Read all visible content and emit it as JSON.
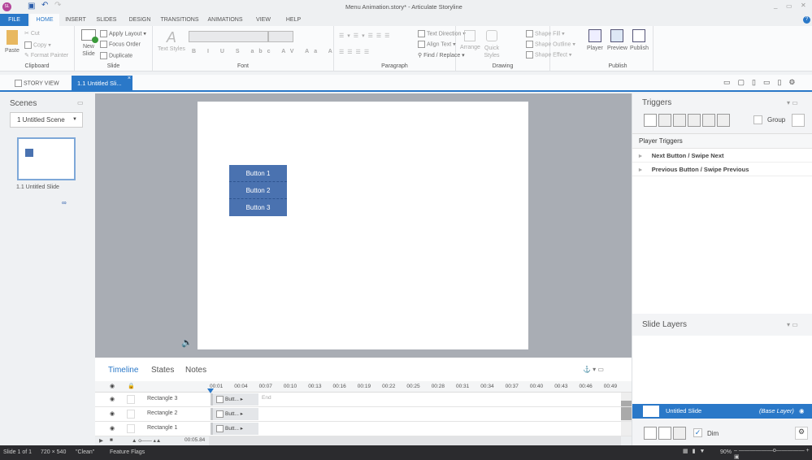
{
  "window": {
    "title": "Menu Animation.story* -  Articulate Storyline",
    "app_icon": "SL"
  },
  "ribbon_tabs": [
    "FILE",
    "HOME",
    "INSERT",
    "SLIDES",
    "DESIGN",
    "TRANSITIONS",
    "ANIMATIONS",
    "VIEW",
    "HELP"
  ],
  "clipboard": {
    "paste": "Paste",
    "cut": "Cut",
    "copy": "Copy",
    "format_painter": "Format Painter",
    "label": "Clipboard"
  },
  "slide_grp": {
    "new_slide": "New Slide",
    "apply_layout": "Apply Layout",
    "focus_order": "Focus Order",
    "duplicate": "Duplicate",
    "label": "Slide"
  },
  "font_grp": {
    "text_styles": "Text Styles",
    "label": "Font"
  },
  "paragraph_grp": {
    "text_direction": "Text Direction",
    "align_text": "Align Text",
    "find_replace": "Find / Replace",
    "label": "Paragraph"
  },
  "drawing_grp": {
    "arrange": "Arrange",
    "quick_styles": "Quick Styles",
    "shape_fill": "Shape Fill",
    "shape_outline": "Shape Outline",
    "shape_effect": "Shape Effect",
    "label": "Drawing"
  },
  "publish_grp": {
    "player": "Player",
    "preview": "Preview",
    "publish": "Publish",
    "label": "Publish"
  },
  "doc_tabs": {
    "story_view": "STORY VIEW",
    "active": "1.1 Untitled Sli..."
  },
  "scenes": {
    "title": "Scenes",
    "dropdown": "1 Untitled Scene",
    "slide_label": "1.1 Untitled Slide"
  },
  "slide": {
    "buttons": [
      "Button 1",
      "Button 2",
      "Button 3"
    ]
  },
  "timeline": {
    "tabs": [
      "Timeline",
      "States",
      "Notes"
    ],
    "ticks": [
      "00:01",
      "00:04",
      "00:07",
      "00:10",
      "00:13",
      "00:16",
      "00:19",
      "00:22",
      "00:25",
      "00:28",
      "00:31",
      "00:34",
      "00:37",
      "00:40",
      "00:43",
      "00:46",
      "00:49"
    ],
    "rows": [
      {
        "name": "Rectangle 3",
        "bar": "Butt..."
      },
      {
        "name": "Rectangle 2",
        "bar": "Butt..."
      },
      {
        "name": "Rectangle 1",
        "bar": "Butt..."
      }
    ],
    "end_label": "End",
    "duration": "00:05.84"
  },
  "triggers": {
    "title": "Triggers",
    "group": "Group",
    "section": "Player Triggers",
    "items": [
      "Next Button / Swipe Next",
      "Previous Button / Swipe Previous"
    ]
  },
  "layers": {
    "title": "Slide Layers",
    "base_name": "Untitled Slide",
    "base_tag": "(Base Layer)",
    "dim": "Dim"
  },
  "status": {
    "slide": "Slide 1 of 1",
    "size": "720 × 540",
    "theme": "\"Clean\"",
    "flags": "Feature Flags",
    "zoom": "90%"
  },
  "colors": {
    "accent": "#2a78c8",
    "button": "#4a72b0",
    "status_bg": "#2b2b2e"
  }
}
